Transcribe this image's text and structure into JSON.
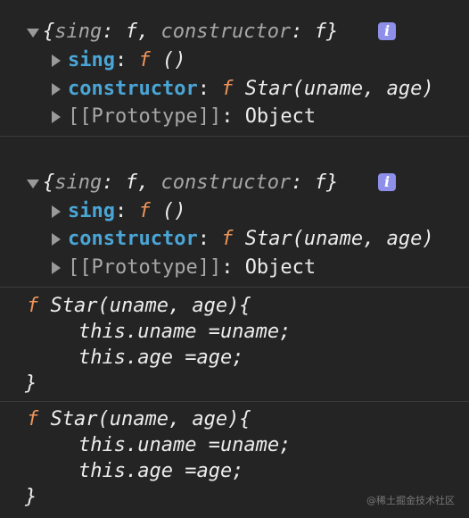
{
  "objects": [
    {
      "summary": {
        "open": "{",
        "k1": "sing",
        "c1": ": ",
        "f1": "f",
        "comma": ", ",
        "k2": "constructor",
        "c2": ": ",
        "f2": "f",
        "close": "}"
      },
      "info_glyph": "i",
      "rows": [
        {
          "key": "sing",
          "colon": ": ",
          "f": "f",
          "value": " ()"
        },
        {
          "key": "constructor",
          "colon": ": ",
          "f": "f",
          "value": " Star(uname, age)"
        },
        {
          "key": "[[Prototype]]",
          "colon": ": ",
          "value": "Object"
        }
      ]
    },
    {
      "summary": {
        "open": "{",
        "k1": "sing",
        "c1": ": ",
        "f1": "f",
        "comma": ", ",
        "k2": "constructor",
        "c2": ": ",
        "f2": "f",
        "close": "}"
      },
      "info_glyph": "i",
      "rows": [
        {
          "key": "sing",
          "colon": ": ",
          "f": "f",
          "value": " ()"
        },
        {
          "key": "constructor",
          "colon": ": ",
          "f": "f",
          "value": " Star(uname, age)"
        },
        {
          "key": "[[Prototype]]",
          "colon": ": ",
          "value": "Object"
        }
      ]
    }
  ],
  "functions": [
    {
      "f": "f",
      "header": " Star(uname, age){",
      "line1": "this.uname =uname;",
      "line2": "this.age =age;",
      "close": "}"
    },
    {
      "f": "f",
      "header": " Star(uname, age){",
      "line1": "this.uname =uname;",
      "line2": "this.age =age;",
      "close": "}"
    }
  ],
  "watermark": "@稀土掘金技术社区",
  "icons": {
    "expand": "triangle-down-icon",
    "collapsed": "triangle-right-icon",
    "info": "info-icon"
  },
  "colors": {
    "background": "#242424",
    "key": "#4aa6d6",
    "function_f": "#f0955a",
    "info_badge": "#8d8fe8"
  }
}
